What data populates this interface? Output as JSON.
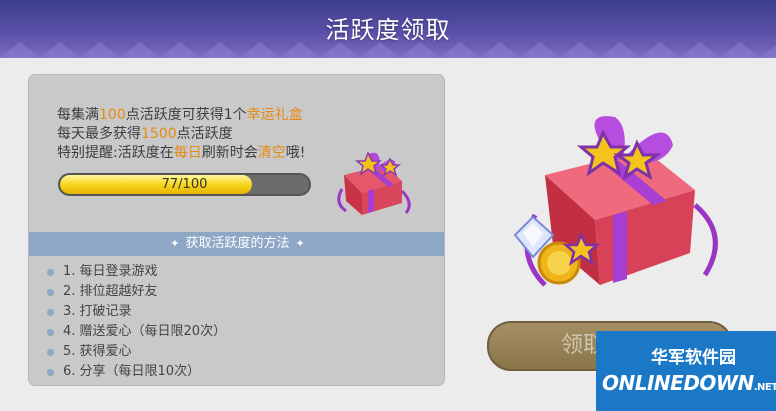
{
  "header": {
    "title": "活跃度领取"
  },
  "info": {
    "line1_pre": "每集满",
    "line1_num": "100",
    "line1_mid": "点活跃度可获得1个",
    "line1_reward": "幸运礼盒",
    "line2_pre": "每天最多获得",
    "line2_num": "1500",
    "line2_post": "点活跃度",
    "line3_pre": "特别提醒:活跃度在",
    "line3_hl1": "每日",
    "line3_mid": "刷新时会",
    "line3_hl2": "清空",
    "line3_post": "哦!"
  },
  "progress": {
    "label": "77/100",
    "fraction": 0.77
  },
  "methods": {
    "title": "获取活跃度的方法",
    "items": [
      "1. 每日登录游戏",
      "2. 排位超越好友",
      "3. 打破记录",
      "4. 赠送爱心（每日限20次）",
      "5. 获得爱心",
      "6. 分享（每日限10次）"
    ]
  },
  "claim_button": {
    "label": "领取"
  },
  "watermark": {
    "cn": "华军软件园",
    "en": "ONLINEDOWN",
    "net": ".NET"
  },
  "colors": {
    "highlight": "#e88a12",
    "header": "#5a4fa6",
    "method_bar": "#8fa7c6"
  }
}
